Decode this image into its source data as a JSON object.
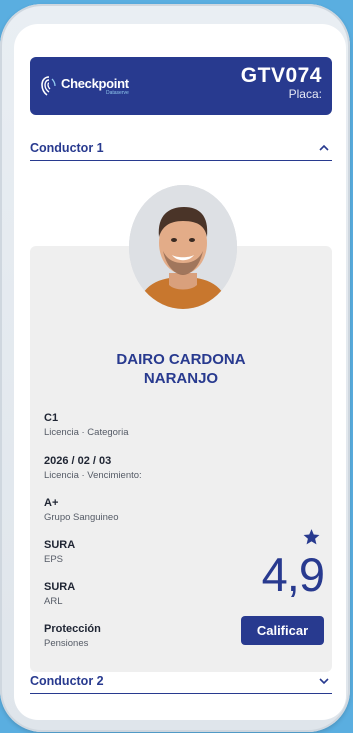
{
  "header": {
    "logo_name": "Checkpoint",
    "logo_sub": "Dataserve",
    "plate_number": "GTV074",
    "plate_label": "Placa:"
  },
  "sections": [
    {
      "title": "Conductor 1",
      "icon": "chevron-up-icon",
      "expanded": true
    },
    {
      "title": "Conductor 2",
      "icon": "chevron-down-icon",
      "expanded": false
    }
  ],
  "driver": {
    "name_line1": "DAIRO CARDONA",
    "name_line2": "NARANJO",
    "fields": [
      {
        "value": "C1",
        "label": "Licencia · Categoria"
      },
      {
        "value": "2026 / 02 / 03",
        "label": "Licencia · Vencimiento:"
      },
      {
        "value": "A+",
        "label": "Grupo Sanguineo"
      },
      {
        "value": "SURA",
        "label": "EPS"
      },
      {
        "value": "SURA",
        "label": "ARL"
      },
      {
        "value": "Protección",
        "label": "Pensiones"
      }
    ],
    "rating": "4,9",
    "rate_button": "Calificar"
  },
  "colors": {
    "primary": "#283a8f",
    "background": "#5aaee0",
    "card": "#efefef"
  }
}
